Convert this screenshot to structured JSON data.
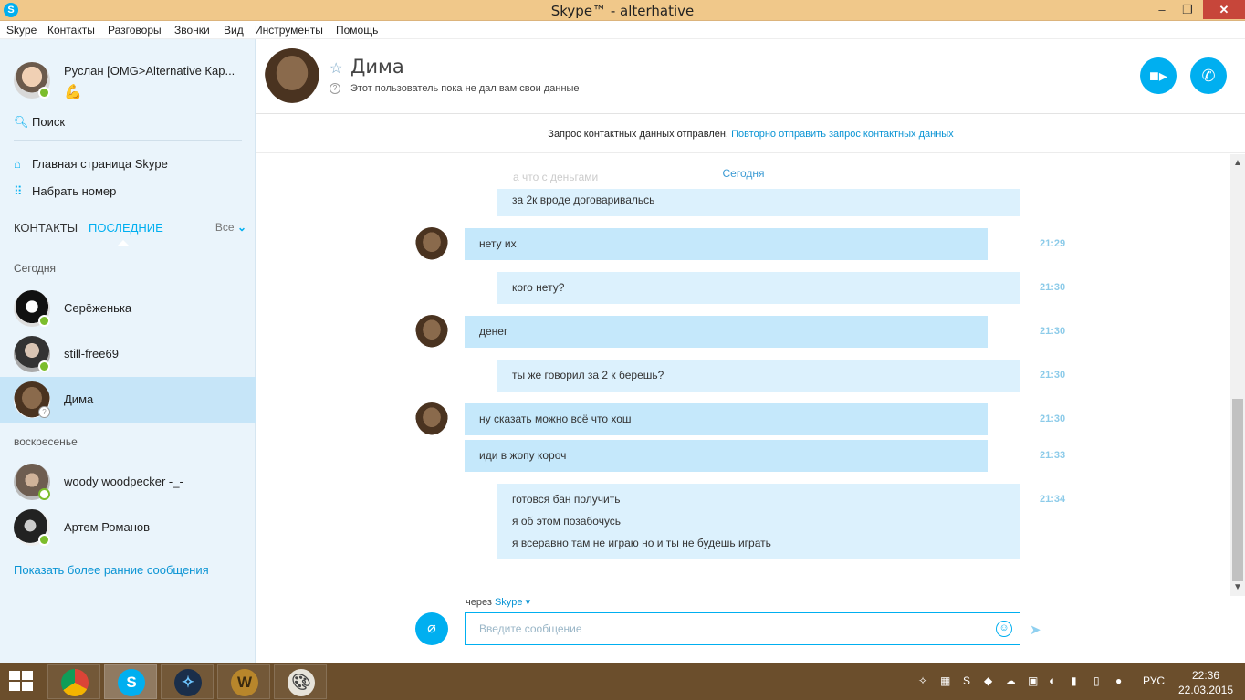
{
  "window": {
    "title": "Skype™ - alterhative"
  },
  "menu": [
    "Skype",
    "Контакты",
    "Разговоры",
    "Звонки",
    "Вид",
    "Инструменты",
    "Помощь"
  ],
  "profile": {
    "name": "Руслан [OMG>Alternative Кар...",
    "mood_icon": "💪"
  },
  "sidebar": {
    "search_label": "Поиск",
    "home_label": "Главная страница Skype",
    "dial_label": "Набрать номер",
    "tab_contacts": "КОНТАКТЫ",
    "tab_recent": "ПОСЛЕДНИЕ",
    "filter": "Все",
    "group_today": "Сегодня",
    "group_sunday": "воскресенье",
    "contacts": [
      {
        "name": "Серёженька",
        "status": "online"
      },
      {
        "name": "still-free69",
        "status": "online"
      },
      {
        "name": "Дима",
        "status": "unknown"
      },
      {
        "name": "woody woodpecker -_-",
        "status": "away"
      },
      {
        "name": "Артем Романов",
        "status": "online"
      }
    ],
    "more_link": "Показать более ранние сообщения"
  },
  "conversation": {
    "name": "Дима",
    "subtitle": "Этот пользователь пока не дал вам свои данные",
    "notice_text": "Запрос контактных данных отправлен.",
    "notice_link": "Повторно отправить запрос контактных данных",
    "date_divider": "Сегодня",
    "faded_text": "а что с деньгами",
    "messages": [
      {
        "text": "за 2к вроде договаривальсь",
        "dir": "out",
        "time": ""
      },
      {
        "text": "нету их",
        "dir": "in",
        "time": "21:29"
      },
      {
        "text": "кого нету?",
        "dir": "out",
        "time": "21:30"
      },
      {
        "text": "денег",
        "dir": "in",
        "time": "21:30"
      },
      {
        "text": "ты же говорил за 2 к берешь?",
        "dir": "out",
        "time": "21:30"
      },
      {
        "text": "ну сказать можно всё что хош",
        "dir": "in",
        "time": "21:30"
      },
      {
        "text": "иди в жопу короч",
        "dir": "in",
        "time": "21:33"
      },
      {
        "text": "готовся бан получить",
        "dir": "out",
        "time": "21:34"
      },
      {
        "text": "я об этом позабочусь",
        "dir": "out",
        "time": ""
      },
      {
        "text": "я всеравно там не играю но и ты не будешь играть",
        "dir": "out",
        "time": ""
      }
    ]
  },
  "composer": {
    "via_label": "через",
    "via_service": "Skype",
    "placeholder": "Введите сообщение"
  },
  "taskbar": {
    "apps": [
      "chrome",
      "skype",
      "battle-net",
      "world-of-warcraft",
      "paint"
    ],
    "lang": "РУС",
    "time": "22:36",
    "date": "22.03.2015"
  }
}
